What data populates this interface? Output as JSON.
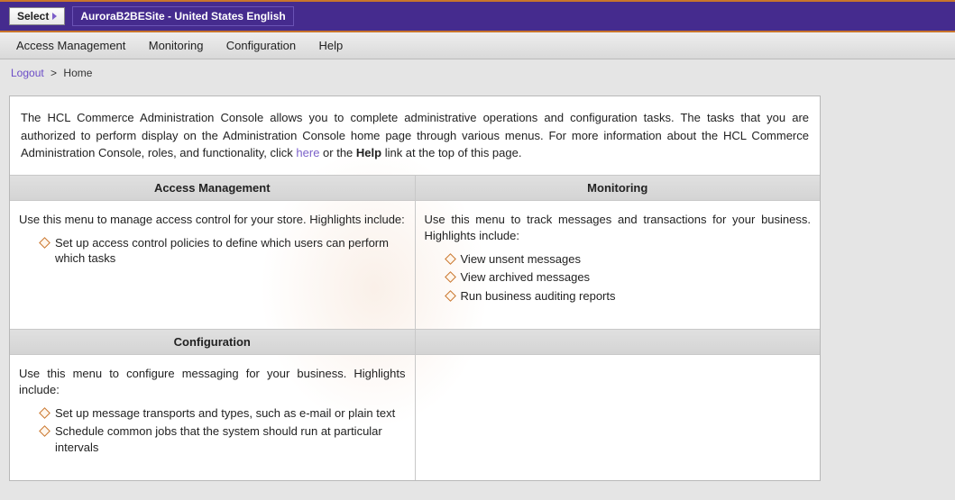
{
  "topbar": {
    "select_label": "Select",
    "site_label": "AuroraB2BESite - United States English"
  },
  "menubar": {
    "items": [
      "Access Management",
      "Monitoring",
      "Configuration",
      "Help"
    ]
  },
  "breadcrumb": {
    "logout": "Logout",
    "sep": ">",
    "current": "Home"
  },
  "intro": {
    "text_before_link": "The HCL Commerce Administration Console allows you to complete administrative operations and configuration tasks. The tasks that you are authorized to perform display on the Administration Console home page through various menus. For more information about the HCL Commerce Administration Console, roles, and functionality, click ",
    "here": "here",
    "text_middle": " or the ",
    "help_bold": "Help",
    "text_after": " link at the top of this page."
  },
  "cards": {
    "access": {
      "title": "Access Management",
      "desc": "Use this menu to manage access control for your store. Highlights include:",
      "items": [
        "Set up access control policies to define which users can perform which tasks"
      ]
    },
    "monitoring": {
      "title": "Monitoring",
      "desc": "Use this menu to track messages and transactions for your business. Highlights include:",
      "items": [
        "View unsent messages",
        "View archived messages",
        "Run business auditing reports"
      ]
    },
    "config": {
      "title": "Configuration",
      "desc": "Use this menu to configure messaging for your business. Highlights include:",
      "items": [
        "Set up message transports and types, such as e-mail or plain text",
        "Schedule common jobs that the system should run at particular intervals"
      ]
    }
  }
}
